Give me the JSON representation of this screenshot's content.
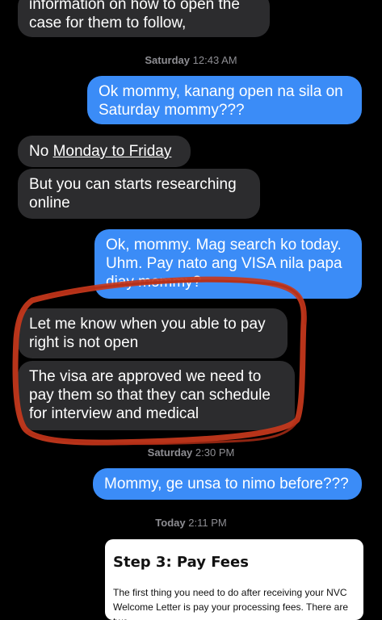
{
  "messages": {
    "m1_line1": "information on how to open the",
    "m1_line2": "case for them to follow,",
    "m2": "Ok mommy, kanang open na sila on Saturday mommy???",
    "m3_prefix": "No ",
    "m3_link": "Monday to Friday",
    "m4": "But you can starts researching online",
    "m5_line1": "Ok, mommy. Mag search ko today.",
    "m5_line2": "Uhm. Pay nato ang VISA nila papa",
    "m5_line3": "diay mommy?",
    "m6": "Let me know when you able to pay right is not open",
    "m7": "The visa are approved we need to pay them so that they can schedule for interview and medical",
    "m8": "Mommy, ge unsa to nimo before???"
  },
  "timestamps": {
    "t1_day": "Saturday",
    "t1_time": "12:43 AM",
    "t2_day": "Saturday",
    "t2_time": "2:30 PM",
    "t3_day": "Today",
    "t3_time": "2:11 PM"
  },
  "card": {
    "title": "Step 3: Pay Fees",
    "body": "The first thing you need to do after receiving your NVC Welcome Letter is pay your processing fees. There are two"
  },
  "colors": {
    "incoming": "#2c2c2e",
    "outgoing": "#3b8cf7",
    "annotation": "#c8381c"
  }
}
